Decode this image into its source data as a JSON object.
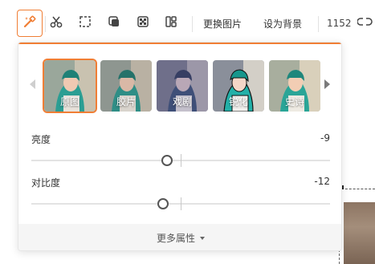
{
  "toolbar": {
    "tools": [
      {
        "icon": "magic-wand-icon",
        "active": true
      },
      {
        "icon": "scissors-icon"
      },
      {
        "icon": "crop-icon"
      },
      {
        "icon": "layer-icon"
      },
      {
        "icon": "mosaic-icon"
      },
      {
        "icon": "layout-icon"
      }
    ],
    "replace_image_label": "更换图片",
    "set_background_label": "设为背景",
    "size_value": "1152",
    "accent_color": "#f07e35"
  },
  "filters": {
    "items": [
      {
        "label": "原图",
        "selected": true
      },
      {
        "label": "胶片"
      },
      {
        "label": "戏剧"
      },
      {
        "label": "锐化"
      },
      {
        "label": "史诗"
      }
    ]
  },
  "adjustments": {
    "brightness": {
      "label": "亮度",
      "value": "-9",
      "level": -9
    },
    "contrast": {
      "label": "对比度",
      "value": "-12",
      "level": -12
    }
  },
  "footer": {
    "more_label": "更多属性"
  }
}
